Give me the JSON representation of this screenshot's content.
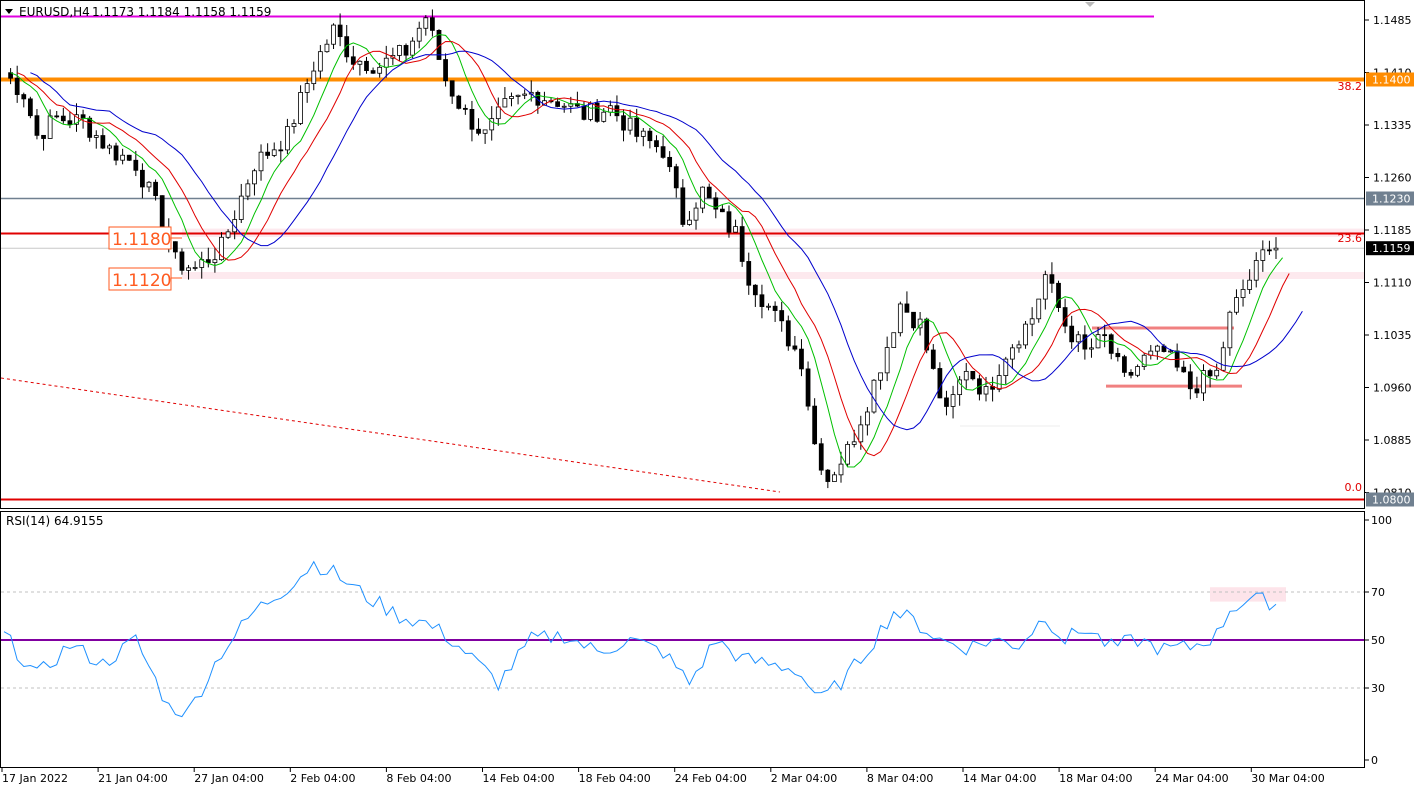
{
  "header": {
    "symbol_label": "EURUSD,H4",
    "ohlc": "1.1173 1.1184 1.1158 1.1159"
  },
  "rsi_panel": {
    "label": "RSI(14) 64.9155",
    "levels": [
      "100",
      "70",
      "50",
      "30",
      "0"
    ]
  },
  "price_axis": {
    "ticks": [
      "1.1485",
      "1.1410",
      "1.1335",
      "1.1260",
      "1.1185",
      "1.1110",
      "1.1035",
      "1.0960",
      "1.0885",
      "1.0810"
    ],
    "tags": [
      {
        "text": "1.1400",
        "color": "#ff8c00"
      },
      {
        "text": "1.1230",
        "color": "#708090"
      },
      {
        "text": "1.1159",
        "color": "#000000"
      },
      {
        "text": "1.0800",
        "color": "#708090"
      }
    ]
  },
  "time_axis": {
    "labels": [
      "17 Jan 2022",
      "21 Jan 04:00",
      "27 Jan 04:00",
      "2 Feb 04:00",
      "8 Feb 04:00",
      "14 Feb 04:00",
      "18 Feb 04:00",
      "24 Feb 04:00",
      "2 Mar 04:00",
      "8 Mar 04:00",
      "14 Mar 04:00",
      "18 Mar 04:00",
      "24 Mar 04:00",
      "30 Mar 04:00"
    ]
  },
  "annotations": {
    "fib_382": "38.2",
    "fib_236": "23.6",
    "fib_00": "0.0",
    "box_1180": "1.1180",
    "box_1120": "1.1120"
  },
  "colors": {
    "ma_fast": "#00c000",
    "ma_mid": "#e00000",
    "ma_slow": "#0000cc",
    "rsi_line": "#1e90ff",
    "magenta_level": "#e000e0",
    "orange_level": "#ff8c00",
    "red_level": "#e00000",
    "gray_level": "#708090"
  },
  "chart_data": {
    "type": "candlestick",
    "instrument": "EURUSD",
    "timeframe": "H4",
    "ylim": [
      1.0795,
      1.1505
    ],
    "close_path": [
      [
        0,
        1.141
      ],
      [
        3,
        1.138
      ],
      [
        5,
        1.132
      ],
      [
        8,
        1.1345
      ],
      [
        12,
        1.134
      ],
      [
        16,
        1.13
      ],
      [
        20,
        1.128
      ],
      [
        24,
        1.12
      ],
      [
        26,
        1.114
      ],
      [
        29,
        1.113
      ],
      [
        33,
        1.116
      ],
      [
        38,
        1.128
      ],
      [
        43,
        1.132
      ],
      [
        47,
        1.142
      ],
      [
        50,
        1.147
      ],
      [
        53,
        1.143
      ],
      [
        57,
        1.142
      ],
      [
        61,
        1.144
      ],
      [
        64,
        1.149
      ],
      [
        67,
        1.14
      ],
      [
        70,
        1.135
      ],
      [
        73,
        1.132
      ],
      [
        76,
        1.136
      ],
      [
        80,
        1.138
      ],
      [
        84,
        1.137
      ],
      [
        88,
        1.135
      ],
      [
        92,
        1.136
      ],
      [
        96,
        1.132
      ],
      [
        100,
        1.13
      ],
      [
        103,
        1.12
      ],
      [
        106,
        1.124
      ],
      [
        108,
        1.121
      ],
      [
        111,
        1.118
      ],
      [
        113,
        1.112
      ],
      [
        117,
        1.106
      ],
      [
        121,
        1.1
      ],
      [
        123,
        1.088
      ],
      [
        125,
        1.083
      ],
      [
        128,
        1.087
      ],
      [
        131,
        1.094
      ],
      [
        134,
        1.102
      ],
      [
        136,
        1.108
      ],
      [
        139,
        1.105
      ],
      [
        141,
        1.098
      ],
      [
        143,
        1.092
      ],
      [
        146,
        1.099
      ],
      [
        149,
        1.095
      ],
      [
        152,
        1.101
      ],
      [
        156,
        1.106
      ],
      [
        158,
        1.112
      ],
      [
        161,
        1.105
      ],
      [
        164,
        1.101
      ],
      [
        167,
        1.103
      ],
      [
        170,
        1.097
      ],
      [
        173,
        1.1
      ],
      [
        176,
        1.101
      ],
      [
        180,
        1.096
      ],
      [
        184,
        1.098
      ],
      [
        186,
        1.106
      ],
      [
        188,
        1.11
      ],
      [
        190,
        1.113
      ],
      [
        192,
        1.117
      ],
      [
        193,
        1.1159
      ]
    ],
    "horizontal_levels": [
      {
        "price": 1.149,
        "color": "magenta"
      },
      {
        "price": 1.14,
        "color": "orange",
        "label": "38.2"
      },
      {
        "price": 1.123,
        "color": "slategray"
      },
      {
        "price": 1.118,
        "color": "red",
        "label": "23.6"
      },
      {
        "price": 1.08,
        "color": "red",
        "label": "0.0"
      }
    ],
    "zones": [
      1.118,
      1.112
    ],
    "last_price": 1.1159,
    "rsi": {
      "period": 14,
      "current": 64.9155,
      "ylim": [
        0,
        100
      ],
      "levels": [
        70,
        50,
        30
      ],
      "path": [
        [
          0,
          52
        ],
        [
          5,
          35
        ],
        [
          10,
          48
        ],
        [
          15,
          40
        ],
        [
          20,
          50
        ],
        [
          25,
          22
        ],
        [
          28,
          20
        ],
        [
          33,
          45
        ],
        [
          38,
          62
        ],
        [
          43,
          72
        ],
        [
          47,
          82
        ],
        [
          50,
          78
        ],
        [
          55,
          68
        ],
        [
          60,
          60
        ],
        [
          64,
          57
        ],
        [
          67,
          52
        ],
        [
          70,
          45
        ],
        [
          75,
          32
        ],
        [
          80,
          50
        ],
        [
          85,
          52
        ],
        [
          90,
          45
        ],
        [
          95,
          50
        ],
        [
          100,
          45
        ],
        [
          104,
          32
        ],
        [
          108,
          50
        ],
        [
          112,
          42
        ],
        [
          116,
          40
        ],
        [
          120,
          38
        ],
        [
          124,
          25
        ],
        [
          128,
          35
        ],
        [
          132,
          50
        ],
        [
          135,
          62
        ],
        [
          138,
          58
        ],
        [
          142,
          50
        ],
        [
          146,
          47
        ],
        [
          150,
          50
        ],
        [
          154,
          48
        ],
        [
          158,
          60
        ],
        [
          161,
          50
        ],
        [
          164,
          55
        ],
        [
          168,
          47
        ],
        [
          172,
          50
        ],
        [
          176,
          46
        ],
        [
          180,
          47
        ],
        [
          184,
          52
        ],
        [
          186,
          63
        ],
        [
          189,
          67
        ],
        [
          192,
          66
        ],
        [
          193,
          64.9
        ]
      ]
    }
  }
}
